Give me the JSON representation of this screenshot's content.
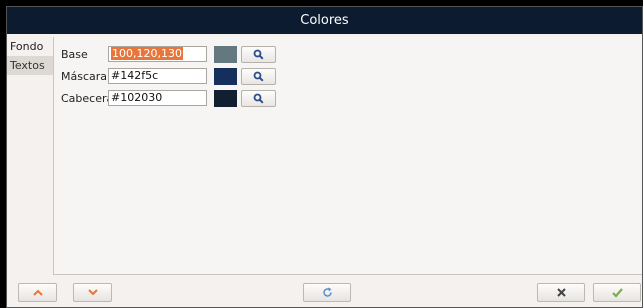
{
  "window": {
    "title": "Colores"
  },
  "tabs": [
    {
      "label": "Fondo"
    },
    {
      "label": "Textos"
    }
  ],
  "rows": [
    {
      "label": "Base",
      "value": "100,120,130",
      "swatch_color": "#64787f"
    },
    {
      "label": "Máscara",
      "value": "#142f5c",
      "swatch_color": "#142f5c"
    },
    {
      "label": "Cabecera",
      "value": "#102030",
      "swatch_color": "#102030"
    }
  ],
  "icons": {
    "search": "search-icon",
    "up": "chevron-up-icon",
    "down": "chevron-down-icon",
    "refresh": "refresh-icon",
    "cancel": "close-icon",
    "ok": "check-icon"
  },
  "colors": {
    "titlebar": "#0d1b31",
    "chevron": "#e8763a",
    "cancel": "#444444",
    "ok": "#7ab04a",
    "refresh": "#5b8fd0"
  }
}
